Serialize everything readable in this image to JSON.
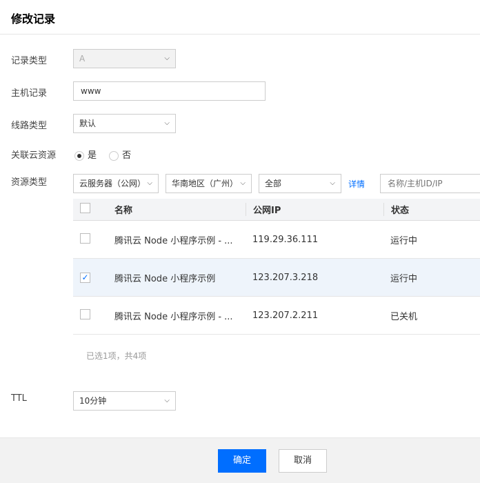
{
  "title": "修改记录",
  "fields": {
    "record_type": {
      "label": "记录类型",
      "value": "A"
    },
    "host": {
      "label": "主机记录",
      "value": "www"
    },
    "line": {
      "label": "线路类型",
      "value": "默认"
    },
    "link": {
      "label": "关联云资源",
      "yes": "是",
      "no": "否",
      "selected": "yes"
    },
    "resource": {
      "label": "资源类型",
      "type": "云服务器（公网）",
      "region": "华南地区（广州）",
      "scope": "全部",
      "detail_link": "详情",
      "search_placeholder": "名称/主机ID/IP"
    },
    "ttl": {
      "label": "TTL",
      "value": "10分钟"
    }
  },
  "table": {
    "headers": [
      "名称",
      "公网IP",
      "状态"
    ],
    "rows": [
      {
        "name": "腾讯云 Node 小程序示例 - ...",
        "ip": "119.29.36.111",
        "status": "运行中",
        "checked": false
      },
      {
        "name": "腾讯云 Node 小程序示例",
        "ip": "123.207.3.218",
        "status": "运行中",
        "checked": true
      },
      {
        "name": "腾讯云 Node 小程序示例 - ...",
        "ip": "123.207.2.211",
        "status": "已关机",
        "checked": false
      }
    ],
    "summary": "已选1项，共4项"
  },
  "buttons": {
    "confirm": "确定",
    "cancel": "取消"
  },
  "colors": {
    "primary": "#006eff",
    "link": "#006eff"
  }
}
